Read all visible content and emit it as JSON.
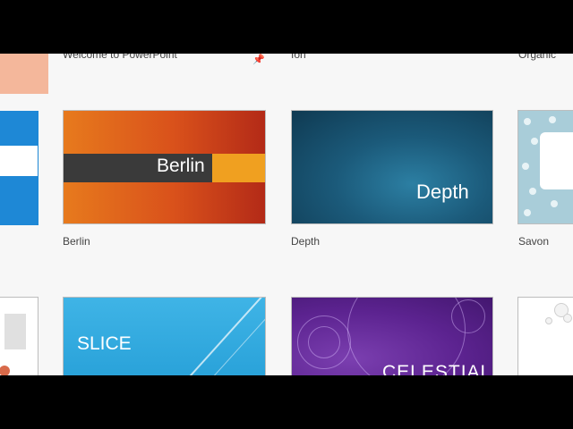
{
  "captions_row0": {
    "welcome": "Welcome to PowerPoint",
    "ion": "Ion",
    "organic": "Organic"
  },
  "templates": {
    "berlin": {
      "title": "Berlin",
      "thumb_text": "Berlin"
    },
    "depth": {
      "title": "Depth",
      "thumb_text": "Depth"
    },
    "savon": {
      "title": "Savon"
    },
    "slice": {
      "thumb_text": "SLICE"
    },
    "celestial": {
      "thumb_text": "CELESTIAL"
    }
  },
  "icons": {
    "pin": "pin-icon"
  },
  "colors": {
    "berlin_band": "#3a3a3a",
    "berlin_accent": "#f0a020",
    "depth_base": "#1b5a7a",
    "slice_base": "#27a0d8",
    "celestial_base": "#5c2390",
    "savon_base": "#a9cdd9"
  }
}
